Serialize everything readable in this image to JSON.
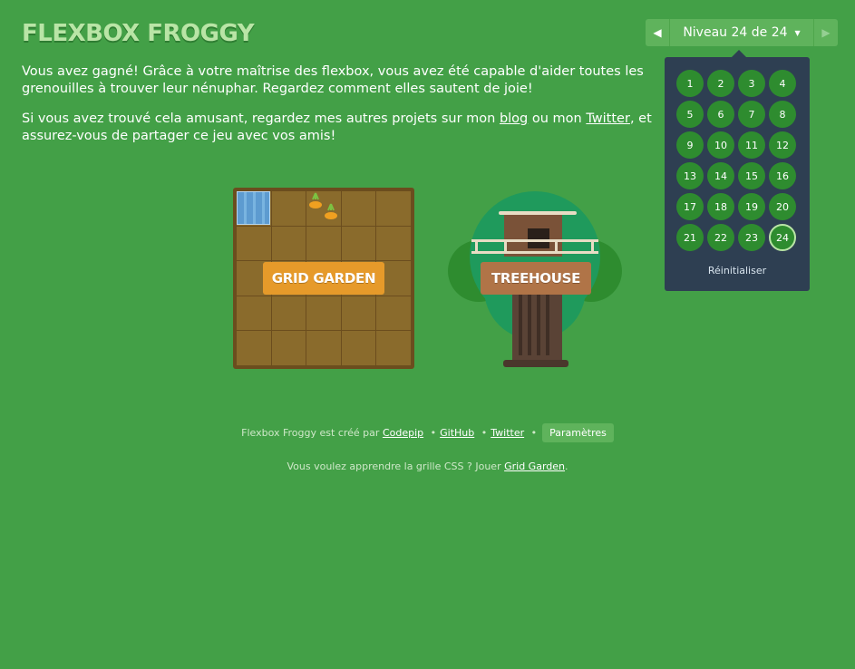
{
  "header": {
    "logo": "FLEXBOX FROGGY"
  },
  "level_nav": {
    "prev_icon": "triangle-left-icon",
    "label": "Niveau 24 de 24",
    "next_icon": "triangle-right-icon"
  },
  "intro": {
    "p1": "Vous avez gagné! Grâce à votre maîtrise des flexbox, vous avez été capable d'aider toutes les grenouilles à trouver leur nénuphar. Regardez comment elles sautent de joie!",
    "p2_before": "Si vous avez trouvé cela amusant, regardez mes autres projets sur mon ",
    "p2_blog": "blog",
    "p2_mid": " ou mon ",
    "p2_twitter": "Twitter",
    "p2_after": ", et assurez-vous de partager ce jeu avec vos amis!"
  },
  "levels": {
    "items": [
      "1",
      "2",
      "3",
      "4",
      "5",
      "6",
      "7",
      "8",
      "9",
      "10",
      "11",
      "12",
      "13",
      "14",
      "15",
      "16",
      "17",
      "18",
      "19",
      "20",
      "21",
      "22",
      "23",
      "24"
    ],
    "current": "24",
    "reset_label": "Réinitialiser"
  },
  "cards": {
    "grid_garden": "GRID GARDEN",
    "treehouse": "TREEHOUSE"
  },
  "footer": {
    "credit_prefix": "Flexbox Froggy est créé par",
    "codepip": "Codepip",
    "github": "GitHub",
    "twitter": "Twitter",
    "separator": "•",
    "settings": "Paramètres",
    "learn_prefix": "Vous voulez apprendre la grille CSS ? Jouer",
    "grid_garden": "Grid Garden",
    "learn_suffix": "."
  },
  "colors": {
    "background": "#43a047",
    "dropdown": "#2e3f52",
    "level_button": "#2e8c2f",
    "garden_button": "#e69a2a",
    "treehouse_button": "#b07447"
  }
}
